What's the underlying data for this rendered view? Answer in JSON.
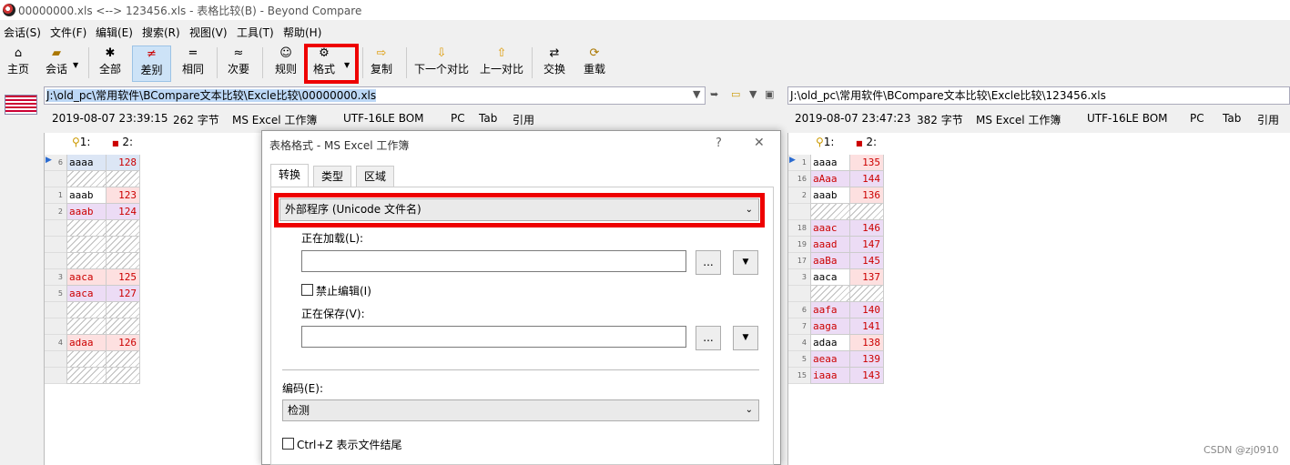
{
  "window": {
    "title": "00000000.xls <--> 123456.xls - 表格比较(B) - Beyond Compare"
  },
  "menu": [
    "会话(S)",
    "文件(F)",
    "编辑(E)",
    "搜索(R)",
    "视图(V)",
    "工具(T)",
    "帮助(H)"
  ],
  "toolbar": {
    "home": "主页",
    "session": "会话",
    "all": "全部",
    "diffs": "差别",
    "same": "相同",
    "minor": "次要",
    "rules": "规则",
    "format": "格式",
    "copy": "复制",
    "next": "下一个对比",
    "prev": "上一对比",
    "swap": "交换",
    "reload": "重载",
    "icons": {
      "home": "house-icon",
      "session": "briefcase-icon",
      "all": "asterisk-icon",
      "diffs": "not-equal-icon",
      "same": "equals-icon",
      "minor": "approx-icon",
      "rules": "person-icon",
      "format": "gear-table-icon",
      "copy": "arrow-right-icon",
      "next": "arrow-down-icon",
      "prev": "arrow-up-icon",
      "swap": "swap-icon",
      "reload": "reload-icon"
    }
  },
  "left": {
    "path": "J:\\old_pc\\常用软件\\BCompare文本比较\\Excle比较\\00000000.xls",
    "info": {
      "date": "2019-08-07 23:39:15",
      "size": "262 字节",
      "type": "MS Excel 工作簿",
      "encoding": "UTF-16LE BOM",
      "line": "PC",
      "tab": "Tab",
      "quote": "引用"
    },
    "headers": {
      "c1": "1:",
      "c2": "2:"
    },
    "rows": [
      {
        "n": "6",
        "a": "aaaa",
        "b": "128",
        "s": "cur"
      },
      {
        "n": "",
        "a": "",
        "b": "",
        "s": "hatch"
      },
      {
        "n": "1",
        "a": "aaab",
        "b": "123",
        "s": "b-pink"
      },
      {
        "n": "2",
        "a": "aaab",
        "b": "124",
        "s": "lilac"
      },
      {
        "n": "",
        "a": "",
        "b": "",
        "s": "hatch"
      },
      {
        "n": "",
        "a": "",
        "b": "",
        "s": "hatch"
      },
      {
        "n": "",
        "a": "",
        "b": "",
        "s": "hatch"
      },
      {
        "n": "3",
        "a": "aaca",
        "b": "125",
        "s": "pink"
      },
      {
        "n": "5",
        "a": "aaca",
        "b": "127",
        "s": "lilac"
      },
      {
        "n": "",
        "a": "",
        "b": "",
        "s": "hatch"
      },
      {
        "n": "",
        "a": "",
        "b": "",
        "s": "hatch"
      },
      {
        "n": "4",
        "a": "adaa",
        "b": "126",
        "s": "pink"
      },
      {
        "n": "",
        "a": "",
        "b": "",
        "s": "hatch"
      },
      {
        "n": "",
        "a": "",
        "b": "",
        "s": "hatch"
      }
    ]
  },
  "right": {
    "path": "J:\\old_pc\\常用软件\\BCompare文本比较\\Excle比较\\123456.xls",
    "info": {
      "date": "2019-08-07 23:47:23",
      "size": "382 字节",
      "type": "MS Excel 工作簿",
      "encoding": "UTF-16LE BOM",
      "line": "PC",
      "tab": "Tab",
      "quote": "引用"
    },
    "headers": {
      "c1": "1:",
      "c2": "2:"
    },
    "rows": [
      {
        "n": "1",
        "a": "aaaa",
        "b": "135",
        "s": "b-pink"
      },
      {
        "n": "16",
        "a": "aAaa",
        "b": "144",
        "s": "lilac"
      },
      {
        "n": "2",
        "a": "aaab",
        "b": "136",
        "s": "b-pink"
      },
      {
        "n": "",
        "a": "",
        "b": "",
        "s": "hatch"
      },
      {
        "n": "18",
        "a": "aaac",
        "b": "146",
        "s": "lilac"
      },
      {
        "n": "19",
        "a": "aaad",
        "b": "147",
        "s": "lilac"
      },
      {
        "n": "17",
        "a": "aaBa",
        "b": "145",
        "s": "lilac"
      },
      {
        "n": "3",
        "a": "aaca",
        "b": "137",
        "s": "b-pink"
      },
      {
        "n": "",
        "a": "",
        "b": "",
        "s": "hatch"
      },
      {
        "n": "6",
        "a": "aafa",
        "b": "140",
        "s": "lilac"
      },
      {
        "n": "7",
        "a": "aaga",
        "b": "141",
        "s": "lilac"
      },
      {
        "n": "4",
        "a": "adaa",
        "b": "138",
        "s": "b-pink"
      },
      {
        "n": "5",
        "a": "aeaa",
        "b": "139",
        "s": "lilac"
      },
      {
        "n": "15",
        "a": "iaaa",
        "b": "143",
        "s": "lilac"
      }
    ]
  },
  "dialog": {
    "title": "表格格式 - MS Excel 工作簿",
    "help": "?",
    "close": "✕",
    "tabs": [
      "转换",
      "类型",
      "区域"
    ],
    "conversion": "外部程序 (Unicode 文件名)",
    "loading_label": "正在加载(L):",
    "loading_value": "",
    "disable_edit": "禁止编辑(I)",
    "saving_label": "正在保存(V):",
    "saving_value": "",
    "browse": "...",
    "encoding_label": "编码(E):",
    "encoding_value": "检测",
    "ctrlz": "Ctrl+Z 表示文件结尾"
  },
  "watermark": "CSDN @zj0910",
  "colors": {
    "highlight": "#e00000",
    "diff_pink": "#fde0e0",
    "diff_lilac": "#ecdcf5",
    "selection": "#bcd7f5"
  }
}
